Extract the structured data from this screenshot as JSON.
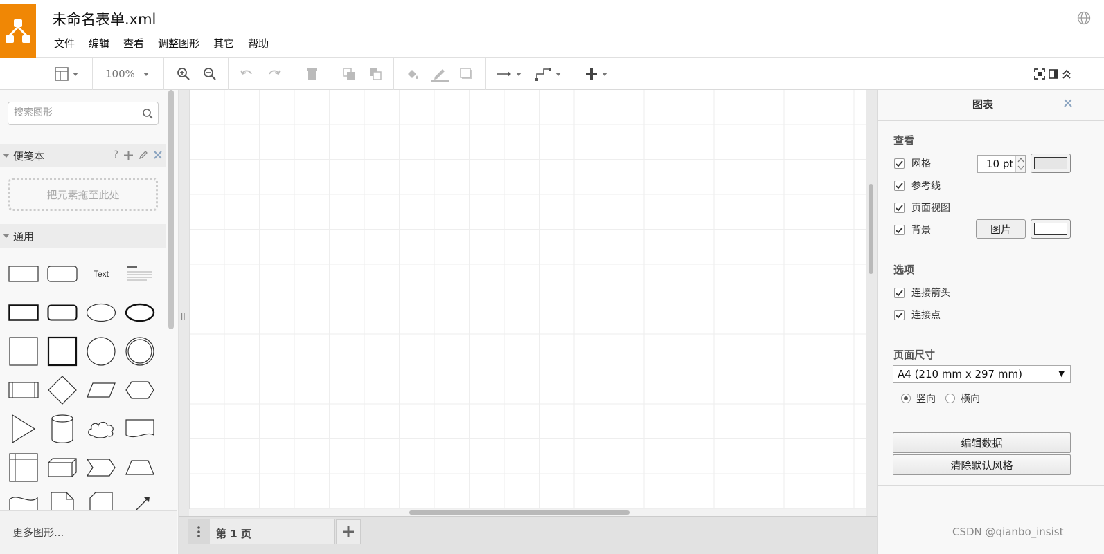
{
  "header": {
    "title": "未命名表单.xml",
    "menu": [
      "文件",
      "编辑",
      "查看",
      "调整图形",
      "其它",
      "帮助"
    ]
  },
  "toolbar": {
    "zoom": "100%"
  },
  "sidebar": {
    "search_placeholder": "搜索图形",
    "scratchpad_title": "便笺本",
    "scratchpad_help": "?",
    "drop_hint": "把元素拖至此处",
    "general_title": "通用",
    "text_shape": "Text",
    "more_shapes": "更多图形..."
  },
  "pages": {
    "current": "第 1 页"
  },
  "panel": {
    "title": "图表",
    "view_title": "查看",
    "grid_label": "网格",
    "grid_size": "10 pt",
    "guides_label": "参考线",
    "page_view_label": "页面视图",
    "background_label": "背景",
    "image_button": "图片",
    "options_title": "选项",
    "connection_arrows_label": "连接箭头",
    "connection_points_label": "连接点",
    "page_size_title": "页面尺寸",
    "page_size_value": "A4 (210 mm x 297 mm)",
    "portrait_label": "竖向",
    "landscape_label": "横向",
    "orientation": "portrait",
    "edit_data_button": "编辑数据",
    "clear_style_button": "清除默认风格",
    "grid_color": "#e6e6e6",
    "background_color": "#ffffff"
  },
  "colors": {
    "logo": "#f08705",
    "grid_line": "#eeeeee"
  },
  "watermark": "CSDN @qianbo_insist"
}
